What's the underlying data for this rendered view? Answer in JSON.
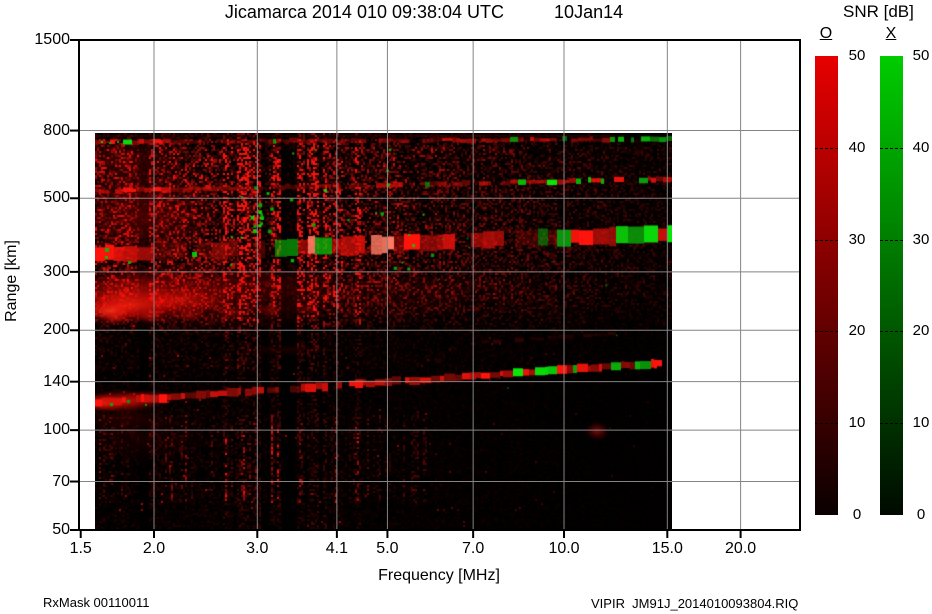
{
  "title": "Jicamarca 2014 010 09:38:04 UTC          10Jan14",
  "axes": {
    "x": {
      "label": "Frequency [MHz]",
      "ticks": [
        "1.5",
        "2.0",
        "3.0",
        "4.1",
        "5.0",
        "7.0",
        "10.0",
        "15.0",
        "20.0"
      ]
    },
    "y": {
      "label": "Range [km]",
      "ticks": [
        "1500",
        "800",
        "500",
        "300",
        "200",
        "140",
        "100",
        "70",
        "50"
      ]
    }
  },
  "colorbar": {
    "title": "SNR [dB]",
    "ticks": [
      "50",
      "40",
      "30",
      "20",
      "10",
      "0"
    ],
    "bars": [
      {
        "label": "O",
        "top_color": "#e60000",
        "bottom_color": "#0a0000"
      },
      {
        "label": "X",
        "top_color": "#00cc00",
        "bottom_color": "#000a00"
      }
    ]
  },
  "footer": {
    "left": "RxMask 00110011",
    "right": "VIPIR  JM91J_2014010093804.RIQ"
  },
  "chart_data": {
    "type": "heatmap",
    "title": "Jicamarca 2014 010 09:38:04 UTC 10Jan14",
    "xlabel": "Frequency [MHz]",
    "ylabel": "Range [km]",
    "x_scale": "log",
    "y_scale": "log",
    "x_ticks": [
      1.5,
      2.0,
      3.0,
      4.1,
      5.0,
      7.0,
      10.0,
      15.0,
      20.0
    ],
    "y_ticks": [
      50,
      70,
      100,
      140,
      200,
      300,
      500,
      800,
      1500
    ],
    "x_range_mhz": [
      1.5,
      25.3
    ],
    "y_range_km": [
      50,
      1500
    ],
    "swept_band_mhz": [
      1.6,
      15.2
    ],
    "sounded_range_km": [
      50,
      780
    ],
    "background": "#000000",
    "legend_position": "right",
    "grid": true,
    "colorbar": {
      "label": "SNR [dB]",
      "min_db": 0,
      "max_db": 50,
      "tick_step_db": 10,
      "polarizations": [
        {
          "name": "O",
          "color": "red"
        },
        {
          "name": "X",
          "color": "green"
        }
      ]
    },
    "echo_features": [
      {
        "name": "E-region slanted trace",
        "freq_mhz": [
          1.6,
          15.2
        ],
        "range_km": [
          122,
          160
        ],
        "intensity": "strong",
        "polarization": "O with X patches above 7 MHz"
      },
      {
        "name": "F-region diffuse echo blob",
        "freq_mhz": [
          1.6,
          4.5
        ],
        "range_km": [
          195,
          260
        ],
        "intensity": "strong at 1.6-2.2 MHz, fading to 4.5 MHz",
        "polarization": "O"
      },
      {
        "name": "multiple-hop echo band",
        "freq_mhz": [
          1.6,
          15.2
        ],
        "range_km": [
          330,
          385
        ],
        "intensity": "strong, segmented",
        "polarization": "O with heavy X mixing above 8 MHz"
      },
      {
        "name": "multiple-hop stripe",
        "freq_mhz": [
          1.6,
          15.2
        ],
        "range_km": [
          520,
          555
        ],
        "intensity": "medium",
        "polarization": "O with X dashes above 8 MHz"
      },
      {
        "name": "multiple-hop stripe",
        "freq_mhz": [
          1.6,
          15.2
        ],
        "range_km": [
          730,
          760
        ],
        "intensity": "medium",
        "polarization": "O, X dashes above 10 MHz"
      },
      {
        "name": "weak isolated echo",
        "freq_mhz": [
          11.0,
          11.8
        ],
        "range_km": [
          95,
          108
        ],
        "intensity": "weak",
        "polarization": "O"
      },
      {
        "name": "broadband noise / RFI vertical striping",
        "freq_mhz": [
          2.5,
          3.6
        ],
        "range_km": [
          50,
          780
        ],
        "intensity": "medium"
      },
      {
        "name": "scattered X-mode specks",
        "freq_mhz": [
          2.4,
          4.8
        ],
        "range_km": [
          300,
          600
        ],
        "intensity": "weak"
      }
    ]
  }
}
